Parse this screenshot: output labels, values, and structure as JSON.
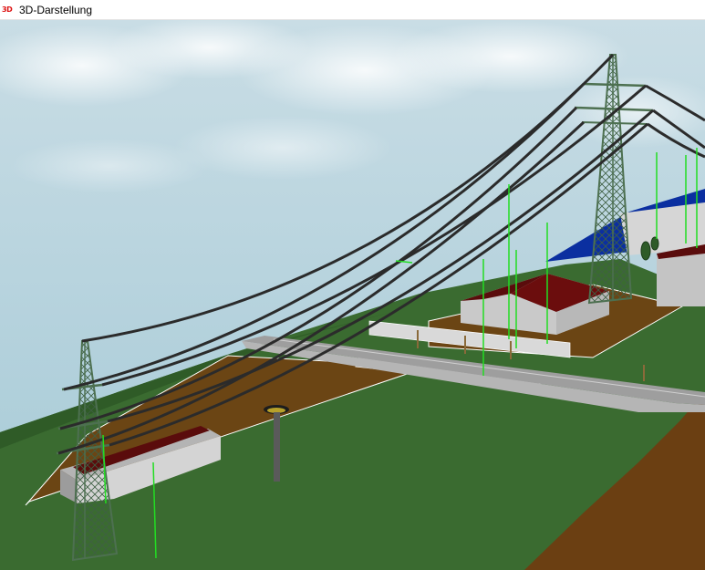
{
  "window": {
    "title": "3D-Darstellung",
    "icon": "3d-app-icon",
    "icon_glyph": "3D"
  },
  "scene": {
    "colors": {
      "sky_top": "#bcd6e0",
      "sky_bottom": "#a8ccd8",
      "grass_dark": "#2c5a26",
      "grass": "#3a6b30",
      "soil": "#6b3f12",
      "water": "#0b2fa0",
      "road": "#a9a9a9",
      "roof": "#5a0c0c",
      "wall": "#c9c9c9",
      "tower": "#4d7050",
      "cable": "#2b2b2b",
      "marker": "#22dd22"
    }
  }
}
